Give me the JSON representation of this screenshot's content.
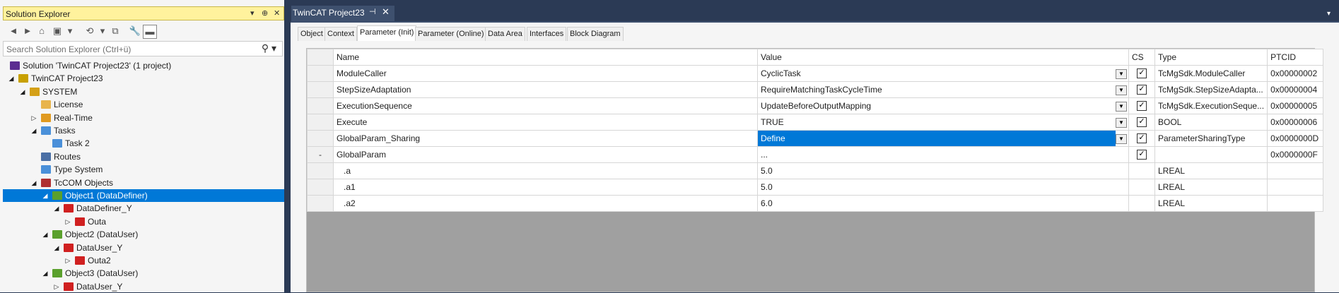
{
  "solution_explorer": {
    "title": "Solution Explorer",
    "controls": [
      "▾",
      "⊕",
      "✕"
    ],
    "search_placeholder": "Search Solution Explorer (Ctrl+ü)",
    "tree": [
      {
        "label": "Solution 'TwinCAT Project23' (1 project)",
        "level": 0,
        "expander": "",
        "icon": "solution-icon",
        "color": "#5c2d91"
      },
      {
        "label": "TwinCAT Project23",
        "level": 0,
        "expander": "◢",
        "icon": "twincat-project-icon",
        "color": "#c8a000"
      },
      {
        "label": "SYSTEM",
        "level": 1,
        "expander": "◢",
        "icon": "system-icon",
        "color": "#d4a017"
      },
      {
        "label": "License",
        "level": 2,
        "expander": "",
        "icon": "license-icon",
        "color": "#e8b44c"
      },
      {
        "label": "Real-Time",
        "level": 2,
        "expander": "▷",
        "icon": "realtime-icon",
        "color": "#e09a20"
      },
      {
        "label": "Tasks",
        "level": 2,
        "expander": "◢",
        "icon": "tasks-icon",
        "color": "#4a90d9"
      },
      {
        "label": "Task 2",
        "level": 3,
        "expander": "",
        "icon": "task-icon",
        "color": "#4a90d9"
      },
      {
        "label": "Routes",
        "level": 2,
        "expander": "",
        "icon": "routes-icon",
        "color": "#4a6fa5"
      },
      {
        "label": "Type System",
        "level": 2,
        "expander": "",
        "icon": "type-system-icon",
        "color": "#4a90d9"
      },
      {
        "label": "TcCOM Objects",
        "level": 2,
        "expander": "◢",
        "icon": "tccom-objects-icon",
        "color": "#b03030"
      },
      {
        "label": "Object1 (DataDefiner)",
        "level": 3,
        "expander": "◢",
        "icon": "object-icon",
        "color": "#5aa02c",
        "selected": true
      },
      {
        "label": "DataDefiner_Y",
        "level": 4,
        "expander": "◢",
        "icon": "module-icon",
        "color": "#d02020"
      },
      {
        "label": "Outa",
        "level": 5,
        "expander": "▷",
        "icon": "output-icon",
        "color": "#d02020"
      },
      {
        "label": "Object2 (DataUser)",
        "level": 3,
        "expander": "◢",
        "icon": "object-icon",
        "color": "#5aa02c"
      },
      {
        "label": "DataUser_Y",
        "level": 4,
        "expander": "◢",
        "icon": "module-icon",
        "color": "#d02020"
      },
      {
        "label": "Outa2",
        "level": 5,
        "expander": "▷",
        "icon": "output-icon",
        "color": "#d02020"
      },
      {
        "label": "Object3 (DataUser)",
        "level": 3,
        "expander": "◢",
        "icon": "object-icon",
        "color": "#5aa02c"
      },
      {
        "label": "DataUser_Y",
        "level": 4,
        "expander": "▷",
        "icon": "module-icon",
        "color": "#d02020"
      }
    ]
  },
  "document": {
    "tab_title": "TwinCAT Project23",
    "tab_pin": "⊣",
    "tab_close": "✕",
    "tabs": [
      "Object",
      "Context",
      "Parameter (Init)",
      "Parameter (Online)",
      "Data Area",
      "Interfaces",
      "Block Diagram"
    ],
    "active_tab": "Parameter (Init)",
    "grid": {
      "headers": [
        "",
        "Name",
        "Value",
        "CS",
        "Type",
        "PTCID"
      ],
      "rows": [
        {
          "rh": "",
          "name": "ModuleCaller",
          "value": "CyclicTask",
          "dropdown": true,
          "cs": true,
          "type": "TcMgSdk.ModuleCaller",
          "ptcid": "0x00000002"
        },
        {
          "rh": "",
          "name": "StepSizeAdaptation",
          "value": "RequireMatchingTaskCycleTime",
          "dropdown": true,
          "cs": true,
          "type": "TcMgSdk.StepSizeAdapta...",
          "ptcid": "0x00000004"
        },
        {
          "rh": "",
          "name": "ExecutionSequence",
          "value": "UpdateBeforeOutputMapping",
          "dropdown": true,
          "cs": true,
          "type": "TcMgSdk.ExecutionSeque...",
          "ptcid": "0x00000005"
        },
        {
          "rh": "",
          "name": "Execute",
          "value": "TRUE",
          "dropdown": true,
          "cs": true,
          "type": "BOOL",
          "ptcid": "0x00000006"
        },
        {
          "rh": "",
          "name": "GlobalParam_Sharing",
          "value": "Define",
          "dropdown": true,
          "cs": true,
          "type": "ParameterSharingType",
          "ptcid": "0x0000000D",
          "selected": true
        },
        {
          "rh": "-",
          "name": "GlobalParam",
          "value": "...",
          "dropdown": false,
          "cs": true,
          "type": "",
          "ptcid": "0x0000000F"
        },
        {
          "rh": "",
          "name": ".a",
          "value": "5.0",
          "dropdown": false,
          "cs": false,
          "type": "LREAL",
          "ptcid": "",
          "indent": true
        },
        {
          "rh": "",
          "name": ".a1",
          "value": "5.0",
          "dropdown": false,
          "cs": false,
          "type": "LREAL",
          "ptcid": "",
          "indent": true
        },
        {
          "rh": "",
          "name": ".a2",
          "value": "6.0",
          "dropdown": false,
          "cs": false,
          "type": "LREAL",
          "ptcid": "",
          "indent": true
        }
      ]
    }
  },
  "colors": {
    "selection": "#0078d7",
    "title_highlight": "#fff29d",
    "doc_frame": "#2b3a55"
  }
}
